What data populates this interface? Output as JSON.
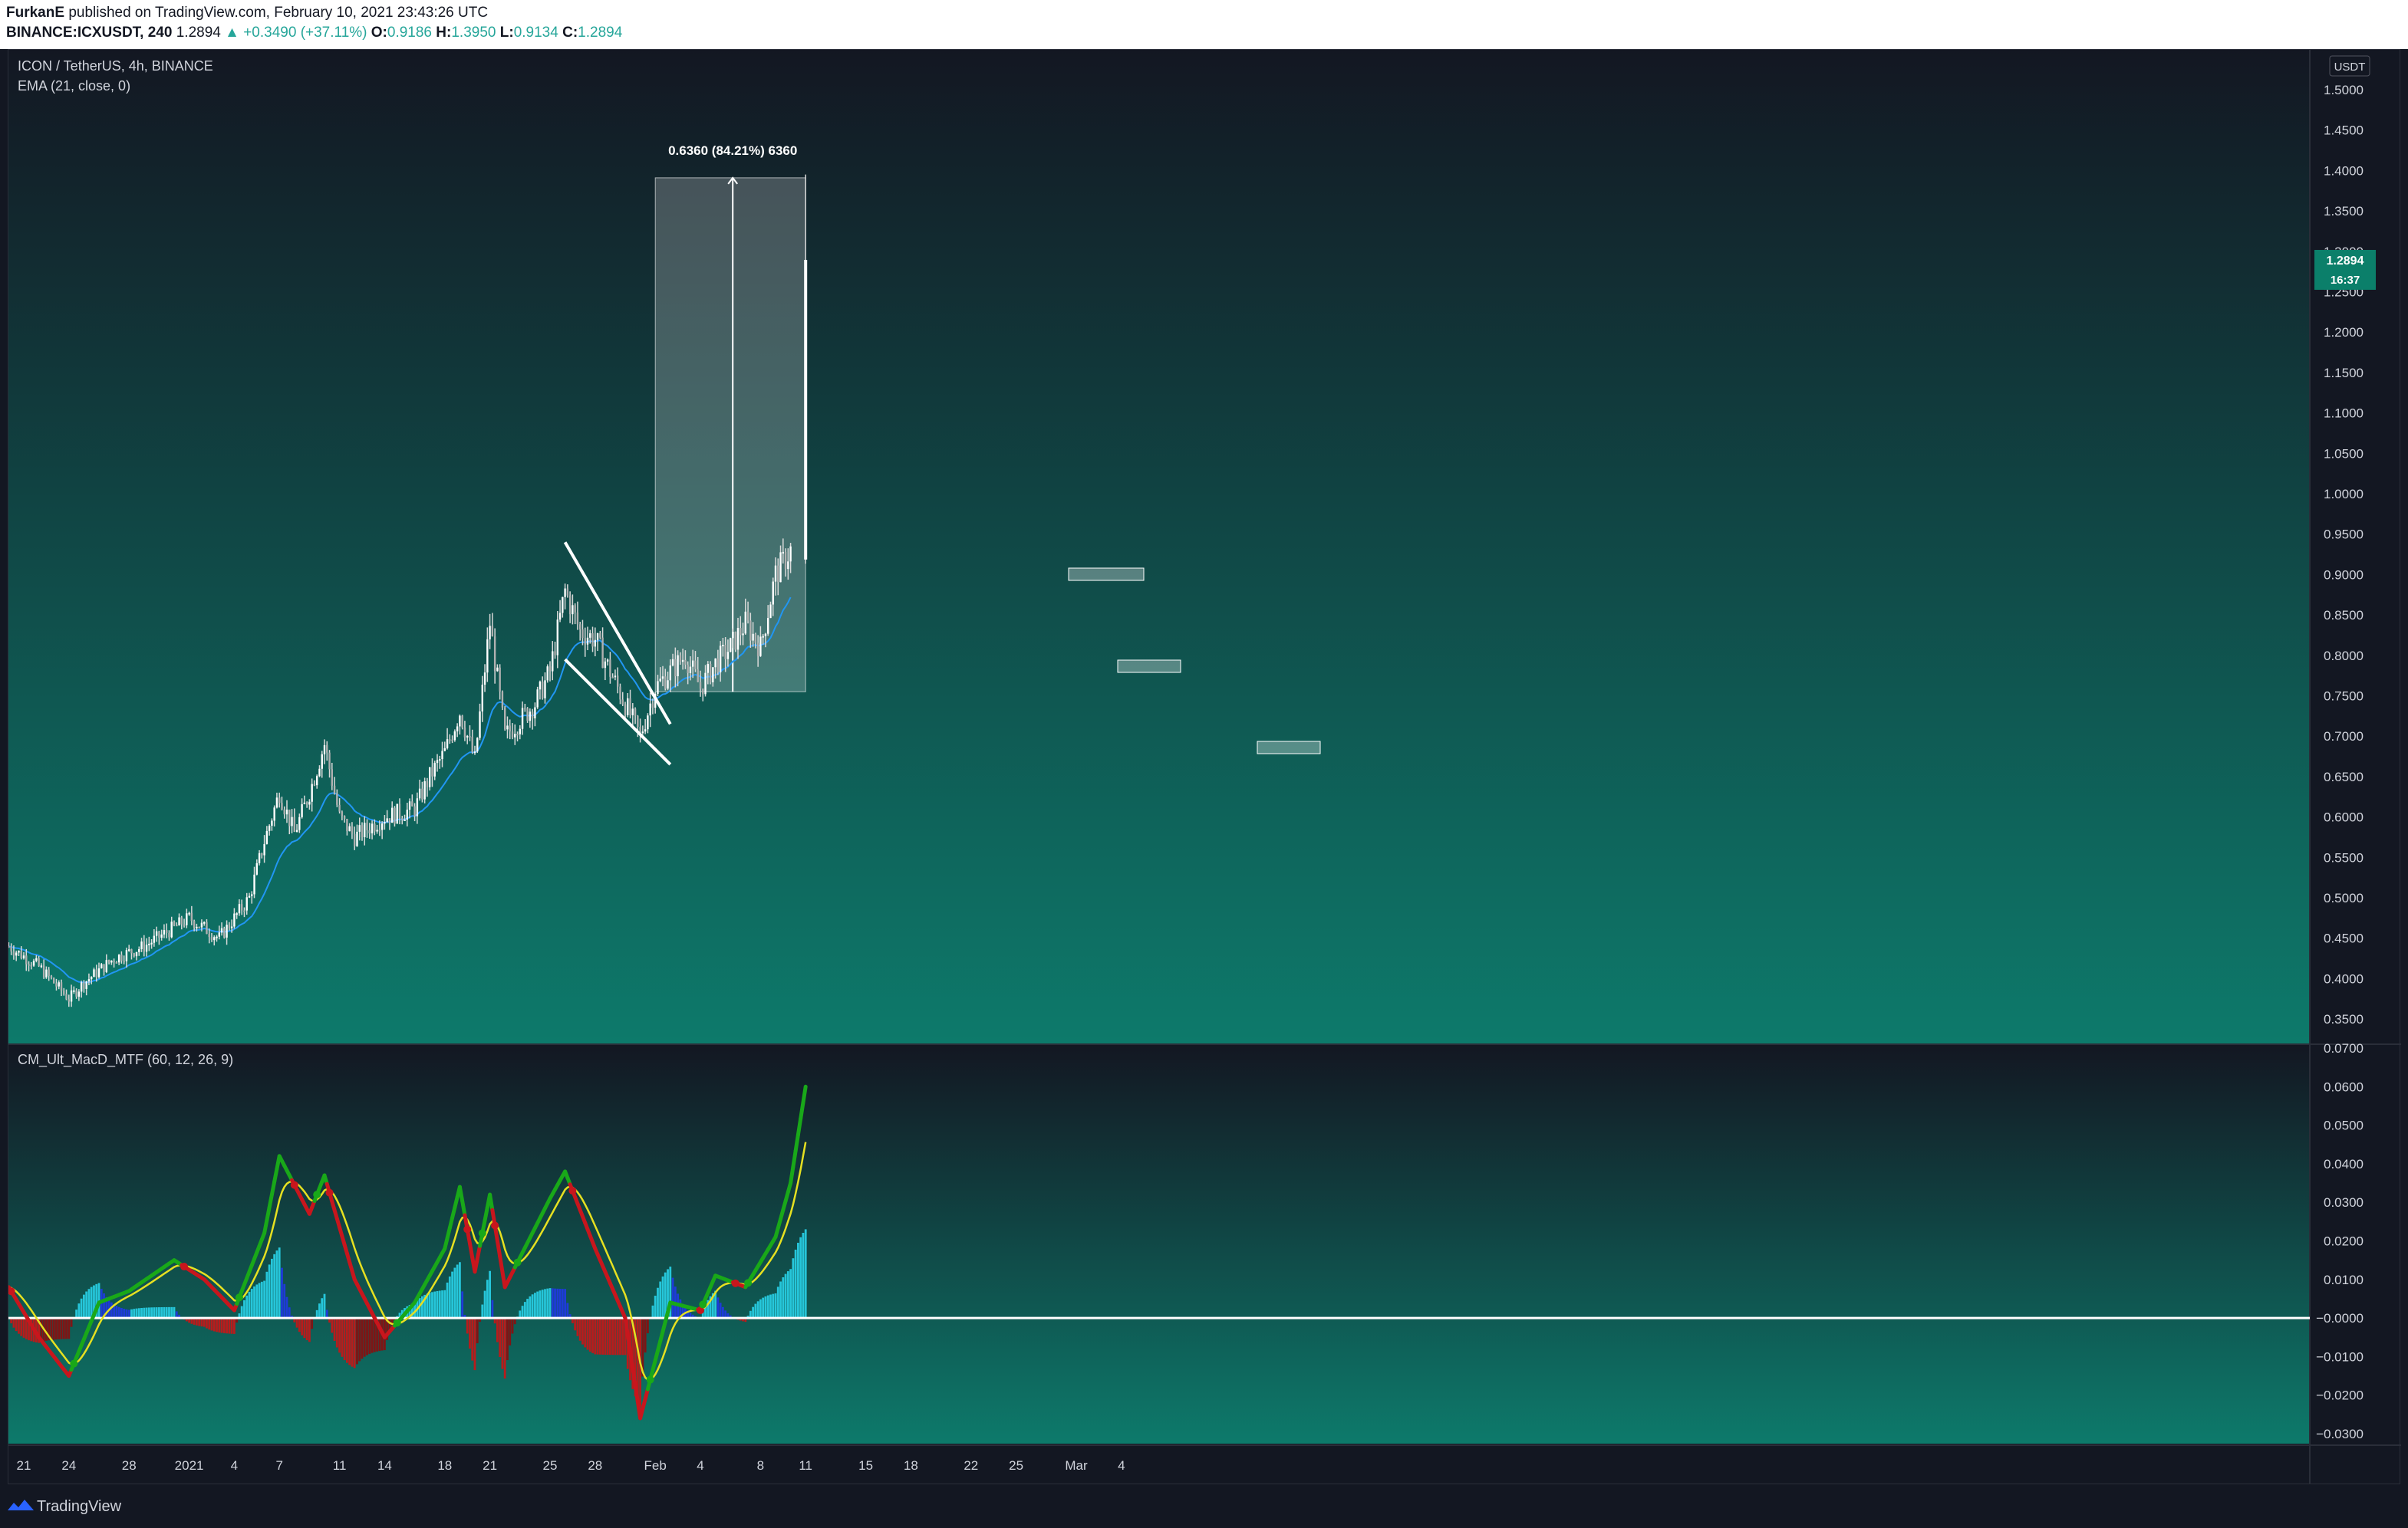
{
  "header": {
    "author": "FurkanE",
    "published_text": "published on TradingView.com, February 10, 2021 23:43:26 UTC",
    "symbol": "BINANCE:ICXUSDT, 240",
    "last": "1.2894",
    "change": "▲ +0.3490 (+37.11%)",
    "o_label": "O:",
    "o": "0.9186",
    "h_label": "H:",
    "h": "1.3950",
    "l_label": "L:",
    "l": "0.9134",
    "c_label": "C:",
    "c": "1.2894"
  },
  "legend": {
    "main_title": "ICON / TetherUS, 4h, BINANCE",
    "ema_label": "EMA (21, close, 0)",
    "macd_label": "CM_Ult_MacD_MTF (60, 12, 26, 9)"
  },
  "price_scale": {
    "currency": "USDT",
    "last_price": "1.2894",
    "countdown": "16:37",
    "ticks": [
      "1.5000",
      "1.4500",
      "1.4000",
      "1.3500",
      "1.3000",
      "1.2500",
      "1.2000",
      "1.1500",
      "1.1000",
      "1.0500",
      "1.0000",
      "0.9500",
      "0.9000",
      "0.8500",
      "0.8000",
      "0.7500",
      "0.7000",
      "0.6500",
      "0.6000",
      "0.5500",
      "0.5000",
      "0.4500",
      "0.4000",
      "0.3500"
    ]
  },
  "macd_scale": {
    "ticks": [
      "0.0700",
      "0.0600",
      "0.0500",
      "0.0400",
      "0.0300",
      "0.0200",
      "0.0100",
      "−0.0000",
      "−0.0100",
      "−0.0200",
      "−0.0300"
    ]
  },
  "time_axis": [
    "21",
    "24",
    "28",
    "2021",
    "4",
    "7",
    "11",
    "14",
    "18",
    "21",
    "25",
    "28",
    "Feb",
    "4",
    "8",
    "11",
    "15",
    "18",
    "22",
    "25",
    "Mar",
    "4"
  ],
  "measure": {
    "label": "0.6360 (84.21%) 6360"
  },
  "footer": {
    "brand": "TradingView"
  },
  "colors": {
    "bg_top": "#131722",
    "bg_bottom": "#0d7a6b",
    "ema": "#2196f3",
    "macd_up": "#19a819",
    "macd_down": "#c8161d",
    "signal": "#e6e021",
    "hist_cyan": "#26c6da",
    "hist_blue": "#1e3bd8",
    "hist_red": "#b71c1c",
    "hist_maroon": "#801414",
    "price_label": "#0b7f6a"
  },
  "chart_data": {
    "type": "candlestick",
    "title": "ICON / TetherUS, 4h, BINANCE",
    "interval": "4h",
    "ylim": [
      0.33,
      1.55
    ],
    "close_series": [
      {
        "date": "2020-12-20",
        "close": 0.44
      },
      {
        "date": "2020-12-22",
        "close": 0.415
      },
      {
        "date": "2020-12-24",
        "close": 0.375
      },
      {
        "date": "2020-12-25",
        "close": 0.395
      },
      {
        "date": "2020-12-27",
        "close": 0.425
      },
      {
        "date": "2020-12-29",
        "close": 0.44
      },
      {
        "date": "2021-01-01",
        "close": 0.475
      },
      {
        "date": "2021-01-03",
        "close": 0.45
      },
      {
        "date": "2021-01-05",
        "close": 0.5
      },
      {
        "date": "2021-01-06",
        "close": 0.57
      },
      {
        "date": "2021-01-07",
        "close": 0.63
      },
      {
        "date": "2021-01-08",
        "close": 0.58
      },
      {
        "date": "2021-01-09",
        "close": 0.63
      },
      {
        "date": "2021-01-10",
        "close": 0.69
      },
      {
        "date": "2021-01-11",
        "close": 0.6
      },
      {
        "date": "2021-01-12",
        "close": 0.575
      },
      {
        "date": "2021-01-14",
        "close": 0.6
      },
      {
        "date": "2021-01-16",
        "close": 0.61
      },
      {
        "date": "2021-01-17",
        "close": 0.65
      },
      {
        "date": "2021-01-18",
        "close": 0.68
      },
      {
        "date": "2021-01-19",
        "close": 0.73
      },
      {
        "date": "2021-01-20",
        "close": 0.67
      },
      {
        "date": "2021-01-21",
        "close": 0.84
      },
      {
        "date": "2021-01-22",
        "close": 0.7
      },
      {
        "date": "2021-01-23",
        "close": 0.72
      },
      {
        "date": "2021-01-24",
        "close": 0.74
      },
      {
        "date": "2021-01-25",
        "close": 0.78
      },
      {
        "date": "2021-01-26",
        "close": 0.88
      },
      {
        "date": "2021-01-27",
        "close": 0.83
      },
      {
        "date": "2021-01-28",
        "close": 0.82
      },
      {
        "date": "2021-01-29",
        "close": 0.78
      },
      {
        "date": "2021-01-30",
        "close": 0.74
      },
      {
        "date": "2021-01-31",
        "close": 0.7
      },
      {
        "date": "2021-02-01",
        "close": 0.76
      },
      {
        "date": "2021-02-02",
        "close": 0.78
      },
      {
        "date": "2021-02-03",
        "close": 0.8
      },
      {
        "date": "2021-02-04",
        "close": 0.76
      },
      {
        "date": "2021-02-05",
        "close": 0.79
      },
      {
        "date": "2021-02-06",
        "close": 0.81
      },
      {
        "date": "2021-02-07",
        "close": 0.84
      },
      {
        "date": "2021-02-08",
        "close": 0.81
      },
      {
        "date": "2021-02-09",
        "close": 0.9
      },
      {
        "date": "2021-02-10",
        "close": 0.93
      },
      {
        "date": "2021-02-11",
        "close": 1.2894
      }
    ],
    "annotations": {
      "measure_from": 0.755,
      "measure_to": 1.391,
      "measure_label": "0.6360 (84.21%) 6360",
      "wedge_upper": [
        {
          "date": "2021-01-26",
          "price": 0.94
        },
        {
          "date": "2021-02-02",
          "price": 0.715
        }
      ],
      "wedge_lower": [
        {
          "date": "2021-01-26",
          "price": 0.795
        },
        {
          "date": "2021-02-02",
          "price": 0.665
        }
      ]
    },
    "macd": {
      "ylim": [
        -0.035,
        0.07
      ],
      "points": [
        {
          "date": "2020-12-20",
          "macd": 0.008
        },
        {
          "date": "2020-12-22",
          "macd": -0.005
        },
        {
          "date": "2020-12-24",
          "macd": -0.015
        },
        {
          "date": "2020-12-26",
          "macd": 0.004
        },
        {
          "date": "2020-12-28",
          "macd": 0.007
        },
        {
          "date": "2020-12-31",
          "macd": 0.015
        },
        {
          "date": "2021-01-02",
          "macd": 0.01
        },
        {
          "date": "2021-01-04",
          "macd": 0.002
        },
        {
          "date": "2021-01-06",
          "macd": 0.022
        },
        {
          "date": "2021-01-07",
          "macd": 0.042
        },
        {
          "date": "2021-01-09",
          "macd": 0.027
        },
        {
          "date": "2021-01-10",
          "macd": 0.037
        },
        {
          "date": "2021-01-12",
          "macd": 0.01
        },
        {
          "date": "2021-01-14",
          "macd": -0.005
        },
        {
          "date": "2021-01-16",
          "macd": 0.004
        },
        {
          "date": "2021-01-18",
          "macd": 0.018
        },
        {
          "date": "2021-01-19",
          "macd": 0.034
        },
        {
          "date": "2021-01-20",
          "macd": 0.012
        },
        {
          "date": "2021-01-21",
          "macd": 0.032
        },
        {
          "date": "2021-01-22",
          "macd": 0.008
        },
        {
          "date": "2021-01-25",
          "macd": 0.031
        },
        {
          "date": "2021-01-26",
          "macd": 0.038
        },
        {
          "date": "2021-01-28",
          "macd": 0.018
        },
        {
          "date": "2021-01-30",
          "macd": 0.0
        },
        {
          "date": "2021-01-31",
          "macd": -0.026
        },
        {
          "date": "2021-02-02",
          "macd": 0.004
        },
        {
          "date": "2021-02-04",
          "macd": 0.002
        },
        {
          "date": "2021-02-05",
          "macd": 0.011
        },
        {
          "date": "2021-02-07",
          "macd": 0.008
        },
        {
          "date": "2021-02-09",
          "macd": 0.021
        },
        {
          "date": "2021-02-10",
          "macd": 0.035
        },
        {
          "date": "2021-02-11",
          "macd": 0.06
        }
      ]
    }
  }
}
